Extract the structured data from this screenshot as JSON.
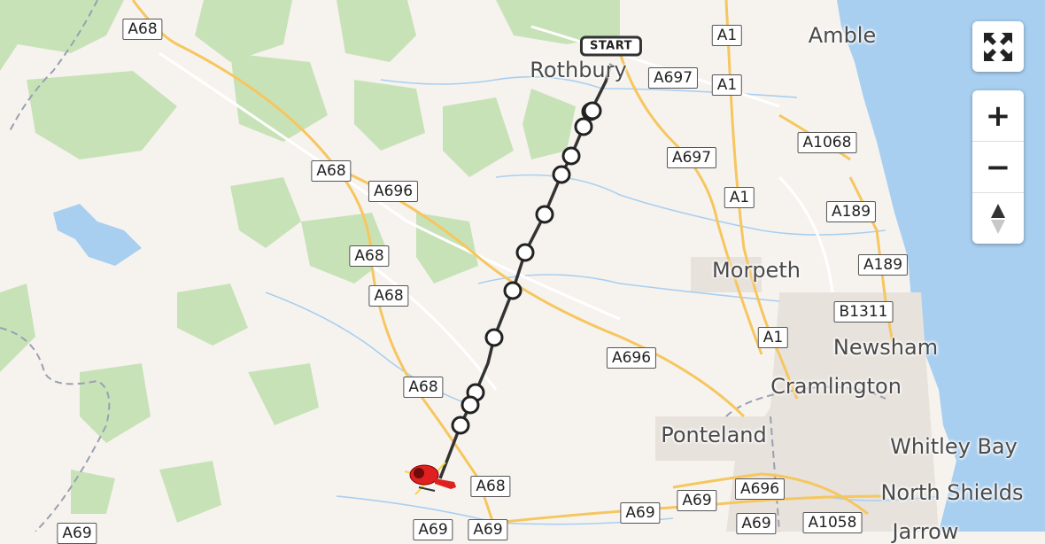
{
  "map": {
    "places": [
      {
        "id": "rothbury",
        "name": "Rothbury"
      },
      {
        "id": "amble",
        "name": "Amble"
      },
      {
        "id": "morpeth",
        "name": "Morpeth"
      },
      {
        "id": "newsham",
        "name": "Newsham"
      },
      {
        "id": "cramlington",
        "name": "Cramlington"
      },
      {
        "id": "ponteland",
        "name": "Ponteland"
      },
      {
        "id": "whitley-bay",
        "name": "Whitley Bay"
      },
      {
        "id": "north-shields",
        "name": "North Shields"
      },
      {
        "id": "jarrow",
        "name": "Jarrow"
      }
    ],
    "roads": [
      "A68",
      "A68",
      "A68",
      "A68",
      "A68",
      "A68",
      "A696",
      "A696",
      "A696",
      "A697",
      "A697",
      "A1",
      "A1",
      "A1",
      "A1",
      "A1068",
      "A189",
      "A189",
      "B1311",
      "A69",
      "A69",
      "A69",
      "A69",
      "A69",
      "A1058",
      "A69"
    ],
    "route": {
      "start_label": "START",
      "waypoint_count": 12
    },
    "colors": {
      "route": "#333333",
      "helicopter": "#e02020",
      "water": "#a8cff0",
      "forest": "#c8e2b8",
      "major_road": "#f6c65f"
    }
  },
  "controls": {
    "fullscreen_icon": "expand-arrows-icon",
    "zoom_in_symbol": "+",
    "zoom_out_symbol": "−",
    "compass_icon": "compass-icon"
  }
}
